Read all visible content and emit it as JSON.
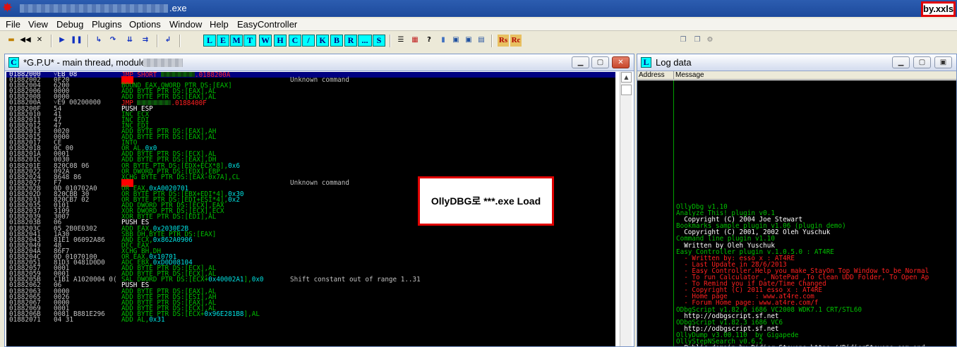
{
  "window": {
    "icon": "app-ollydbg-icon",
    "title_suffix": ".exe",
    "tag": "by.xxls"
  },
  "menu": [
    "File",
    "View",
    "Debug",
    "Plugins",
    "Options",
    "Window",
    "Help",
    "EasyController"
  ],
  "toolbar": {
    "letters": [
      "L",
      "E",
      "M",
      "T",
      "W",
      "H",
      "C",
      "/",
      "K",
      "B",
      "R",
      "...",
      "S"
    ],
    "plugins": [
      "Rs",
      "Rc"
    ]
  },
  "cpu": {
    "icon_letter": "C",
    "title": "*G.P.U* - main thread, module",
    "rows": [
      {
        "addr": "01882000",
        "hex": "˅EB 08",
        "parts": [
          [
            "r",
            "JMP SHORT "
          ],
          [
            "blur",
            ""
          ],
          [
            "r",
            ".0188200A"
          ]
        ],
        "cmt": "",
        "sel": true
      },
      {
        "addr": "01882002",
        "hex": "0F20",
        "parts": [
          [
            "redbox",
            "???"
          ]
        ],
        "cmt": "Unknown command"
      },
      {
        "addr": "01882004",
        "hex": "6200",
        "parts": [
          [
            "g",
            "BOUND EAX,QWORD PTR DS:[EAX]"
          ]
        ],
        "cmt": ""
      },
      {
        "addr": "01882006",
        "hex": "0000",
        "parts": [
          [
            "g",
            "ADD BYTE PTR DS:[EAX],AL"
          ]
        ],
        "cmt": ""
      },
      {
        "addr": "01882008",
        "hex": "0000",
        "parts": [
          [
            "g",
            "ADD BYTE PTR DS:[EAX],AL"
          ]
        ],
        "cmt": ""
      },
      {
        "addr": "0188200A",
        "hex": "˅E9 00200000",
        "parts": [
          [
            "r",
            "JMP "
          ],
          [
            "blur",
            ""
          ],
          [
            "r",
            ".0188400F"
          ]
        ],
        "cmt": ""
      },
      {
        "addr": "0188200F",
        "hex": "54",
        "parts": [
          [
            "w",
            "PUSH ESP"
          ]
        ],
        "cmt": ""
      },
      {
        "addr": "01882010",
        "hex": "41",
        "parts": [
          [
            "g",
            "INC ECX"
          ]
        ],
        "cmt": ""
      },
      {
        "addr": "01882011",
        "hex": "47",
        "parts": [
          [
            "g",
            "INC EDI"
          ]
        ],
        "cmt": ""
      },
      {
        "addr": "01882012",
        "hex": "47",
        "parts": [
          [
            "g",
            "INC EDI"
          ]
        ],
        "cmt": ""
      },
      {
        "addr": "01882013",
        "hex": "0020",
        "parts": [
          [
            "g",
            "ADD BYTE PTR DS:[EAX],AH"
          ]
        ],
        "cmt": ""
      },
      {
        "addr": "01882015",
        "hex": "0000",
        "parts": [
          [
            "g",
            "ADD BYTE PTR DS:[EAX],AL"
          ]
        ],
        "cmt": ""
      },
      {
        "addr": "01882017",
        "hex": "CE",
        "parts": [
          [
            "g",
            "INTO"
          ]
        ],
        "cmt": ""
      },
      {
        "addr": "01882018",
        "hex": "0C 00",
        "parts": [
          [
            "g",
            "OR AL,"
          ],
          [
            "cy",
            "0x0"
          ]
        ],
        "cmt": ""
      },
      {
        "addr": "0188201A",
        "hex": "0001",
        "parts": [
          [
            "g",
            "ADD BYTE PTR DS:[ECX],AL"
          ]
        ],
        "cmt": ""
      },
      {
        "addr": "0188201C",
        "hex": "0030",
        "parts": [
          [
            "g",
            "ADD BYTE PTR DS:[EAX],DH"
          ]
        ],
        "cmt": ""
      },
      {
        "addr": "0188201E",
        "hex": "820C08 06",
        "parts": [
          [
            "g",
            "OR BYTE PTR DS:[EDX+ECX*8],"
          ],
          [
            "cy",
            "0x6"
          ]
        ],
        "cmt": ""
      },
      {
        "addr": "01882022",
        "hex": "092A",
        "parts": [
          [
            "g",
            "OR DWORD PTR DS:[EDX],EBP"
          ]
        ],
        "cmt": ""
      },
      {
        "addr": "01882024",
        "hex": "8648 86",
        "parts": [
          [
            "g",
            "XCHG BYTE PTR DS:[EAX-0x7A],CL"
          ]
        ],
        "cmt": ""
      },
      {
        "addr": "01882027",
        "hex": "F7",
        "parts": [
          [
            "redbox",
            "???"
          ]
        ],
        "cmt": "Unknown command"
      },
      {
        "addr": "01882028",
        "hex": "0D 010702A0",
        "parts": [
          [
            "g",
            "OR EAX,"
          ],
          [
            "cy",
            "0xA0020701"
          ]
        ],
        "cmt": ""
      },
      {
        "addr": "0188202D",
        "hex": "820CBB 30",
        "parts": [
          [
            "g",
            "OR BYTE PTR DS:[EBX+EDI*4],"
          ],
          [
            "cy",
            "0x30"
          ]
        ],
        "cmt": ""
      },
      {
        "addr": "01882031",
        "hex": "820CB7 02",
        "parts": [
          [
            "g",
            "OR BYTE PTR DS:[EDI+ESI*4],"
          ],
          [
            "cy",
            "0x2"
          ]
        ],
        "cmt": ""
      },
      {
        "addr": "01882035",
        "hex": "0101",
        "parts": [
          [
            "g",
            "ADD DWORD PTR DS:[ECX],EAX"
          ]
        ],
        "cmt": ""
      },
      {
        "addr": "01882037",
        "hex": "3109",
        "parts": [
          [
            "g",
            "XOR DWORD PTR DS:[ECX],ECX"
          ]
        ],
        "cmt": ""
      },
      {
        "addr": "01882039",
        "hex": "3007",
        "parts": [
          [
            "g",
            "XOR BYTE PTR DS:[EDI],AL"
          ]
        ],
        "cmt": ""
      },
      {
        "addr": "0188203B",
        "hex": "06",
        "parts": [
          [
            "w",
            "PUSH ES"
          ]
        ],
        "cmt": ""
      },
      {
        "addr": "0188203C",
        "hex": "05 2B0E0302",
        "parts": [
          [
            "g",
            "ADD EAX,"
          ],
          [
            "cy",
            "0x2030E2B"
          ]
        ],
        "cmt": ""
      },
      {
        "addr": "01882041",
        "hex": "1A30",
        "parts": [
          [
            "g",
            "SBB DH,BYTE PTR DS:[EAX]"
          ]
        ],
        "cmt": ""
      },
      {
        "addr": "01882043",
        "hex": "81E1 06092A86",
        "parts": [
          [
            "g",
            "AND ECX,"
          ],
          [
            "cy",
            "0x862A0906"
          ]
        ],
        "cmt": ""
      },
      {
        "addr": "01882049",
        "hex": "48",
        "parts": [
          [
            "g",
            "DEC EAX"
          ]
        ],
        "cmt": ""
      },
      {
        "addr": "0188204A",
        "hex": "86F7",
        "parts": [
          [
            "g",
            "XCHG BH,DH"
          ]
        ],
        "cmt": ""
      },
      {
        "addr": "0188204C",
        "hex": "0D 01070100",
        "parts": [
          [
            "g",
            "OR EAX,"
          ],
          [
            "cy",
            "0x10701"
          ]
        ],
        "cmt": ""
      },
      {
        "addr": "01882051",
        "hex": "81D3 0481D0D0",
        "parts": [
          [
            "g",
            "ADC EBX,"
          ],
          [
            "cy",
            "0xD0D08104"
          ]
        ],
        "cmt": ""
      },
      {
        "addr": "01882057",
        "hex": "0001",
        "parts": [
          [
            "g",
            "ADD BYTE PTR DS:[ECX],AL"
          ]
        ],
        "cmt": ""
      },
      {
        "addr": "01882059",
        "hex": "0001",
        "parts": [
          [
            "g",
            "ADD BYTE PTR DS:[ECX],AL"
          ]
        ],
        "cmt": ""
      },
      {
        "addr": "0188205B",
        "hex": "C1B1 A1020004 0(",
        "parts": [
          [
            "g",
            "SAL DWORD PTR DS:[ECX+"
          ],
          [
            "cy",
            "0x40002A1"
          ],
          [
            "g",
            "],"
          ],
          [
            "cy",
            "0x0"
          ]
        ],
        "cmt": "Shift constant out of range 1..31"
      },
      {
        "addr": "01882062",
        "hex": "06",
        "parts": [
          [
            "w",
            "PUSH ES"
          ]
        ],
        "cmt": ""
      },
      {
        "addr": "01882063",
        "hex": "0000",
        "parts": [
          [
            "g",
            "ADD BYTE PTR DS:[EAX],AL"
          ]
        ],
        "cmt": ""
      },
      {
        "addr": "01882065",
        "hex": "0026",
        "parts": [
          [
            "g",
            "ADD BYTE PTR DS:[ESI],AH"
          ]
        ],
        "cmt": ""
      },
      {
        "addr": "01882067",
        "hex": "0000",
        "parts": [
          [
            "g",
            "ADD BYTE PTR DS:[EAX],AL"
          ]
        ],
        "cmt": ""
      },
      {
        "addr": "01882069",
        "hex": "0001",
        "parts": [
          [
            "g",
            "ADD BYTE PTR DS:[ECX],AL"
          ]
        ],
        "cmt": ""
      },
      {
        "addr": "0188206B",
        "hex": "0081 B881E296",
        "parts": [
          [
            "g",
            "ADD BYTE PTR DS:[ECX+"
          ],
          [
            "cy",
            "0x96E281B8"
          ],
          [
            "g",
            "],AL"
          ]
        ],
        "cmt": ""
      },
      {
        "addr": "01882071",
        "hex": "04 31",
        "parts": [
          [
            "g",
            "ADD AL,"
          ],
          [
            "cy",
            "0x31"
          ]
        ],
        "cmt": ""
      }
    ]
  },
  "callout": "OllyDBG로 ***.exe Load",
  "log": {
    "icon_letter": "L",
    "title": "Log data",
    "columns": [
      "Address",
      "Message"
    ],
    "lines": [
      [
        "lg",
        "OllyDbg v1.10"
      ],
      [
        "lg",
        "Analyze This! plugin v0.1"
      ],
      [
        "lw",
        "  Copyright (C) 2004 Joe Stewart"
      ],
      [
        "lg",
        "Bookmarks sample plugin v1.06 (plugin demo)"
      ],
      [
        "lw",
        "  Copyright (C) 2001, 2002 Oleh Yuschuk"
      ],
      [
        "lg",
        "Command line plugin v1.10"
      ],
      [
        "lw",
        "  Written by Oleh Yuschuk"
      ],
      [
        "lg",
        "Easy Controller plugin v.1.0.5.0 : AT4RE"
      ],
      [
        "lr",
        "  - Written by: esso_x : AT4RE"
      ],
      [
        "lr",
        "  - Last Update in 28/6/2013"
      ],
      [
        "lr",
        "  - Easy Controller.Help you make StayOn Top Window to be Normal"
      ],
      [
        "lr",
        "  - To run Calculator , NotePad ,To Clean UDD Folder, To Open Ap"
      ],
      [
        "lr",
        "  - To Remind you if Date/Time Changed"
      ],
      [
        "lr",
        "  - Copyright (C) 2011 esso_x : AT4RE"
      ],
      [
        "lr",
        "  - Home page       : www.at4re.com"
      ],
      [
        "lr",
        "  - Forum Home page: www.at4re.com/f"
      ],
      [
        "lg",
        "ODbgScript v1.82.6 i686 VC2008 WDK7.1 CRT/STL60"
      ],
      [
        "lw",
        "  http://odbgscript.sf.net"
      ],
      [
        "lg",
        "ODbgScript v1.82.3 i686 VC6"
      ],
      [
        "lw",
        "  http://odbgscript.sf.net"
      ],
      [
        "lg",
        "OllyDump v3.00.110  by Gigapede"
      ],
      [
        "lg",
        "OllyStepNSearch v0.6.2"
      ],
      [
        "lw",
        "  Public domain by Didier Stevens https://DidierStevens.com and"
      ]
    ]
  }
}
